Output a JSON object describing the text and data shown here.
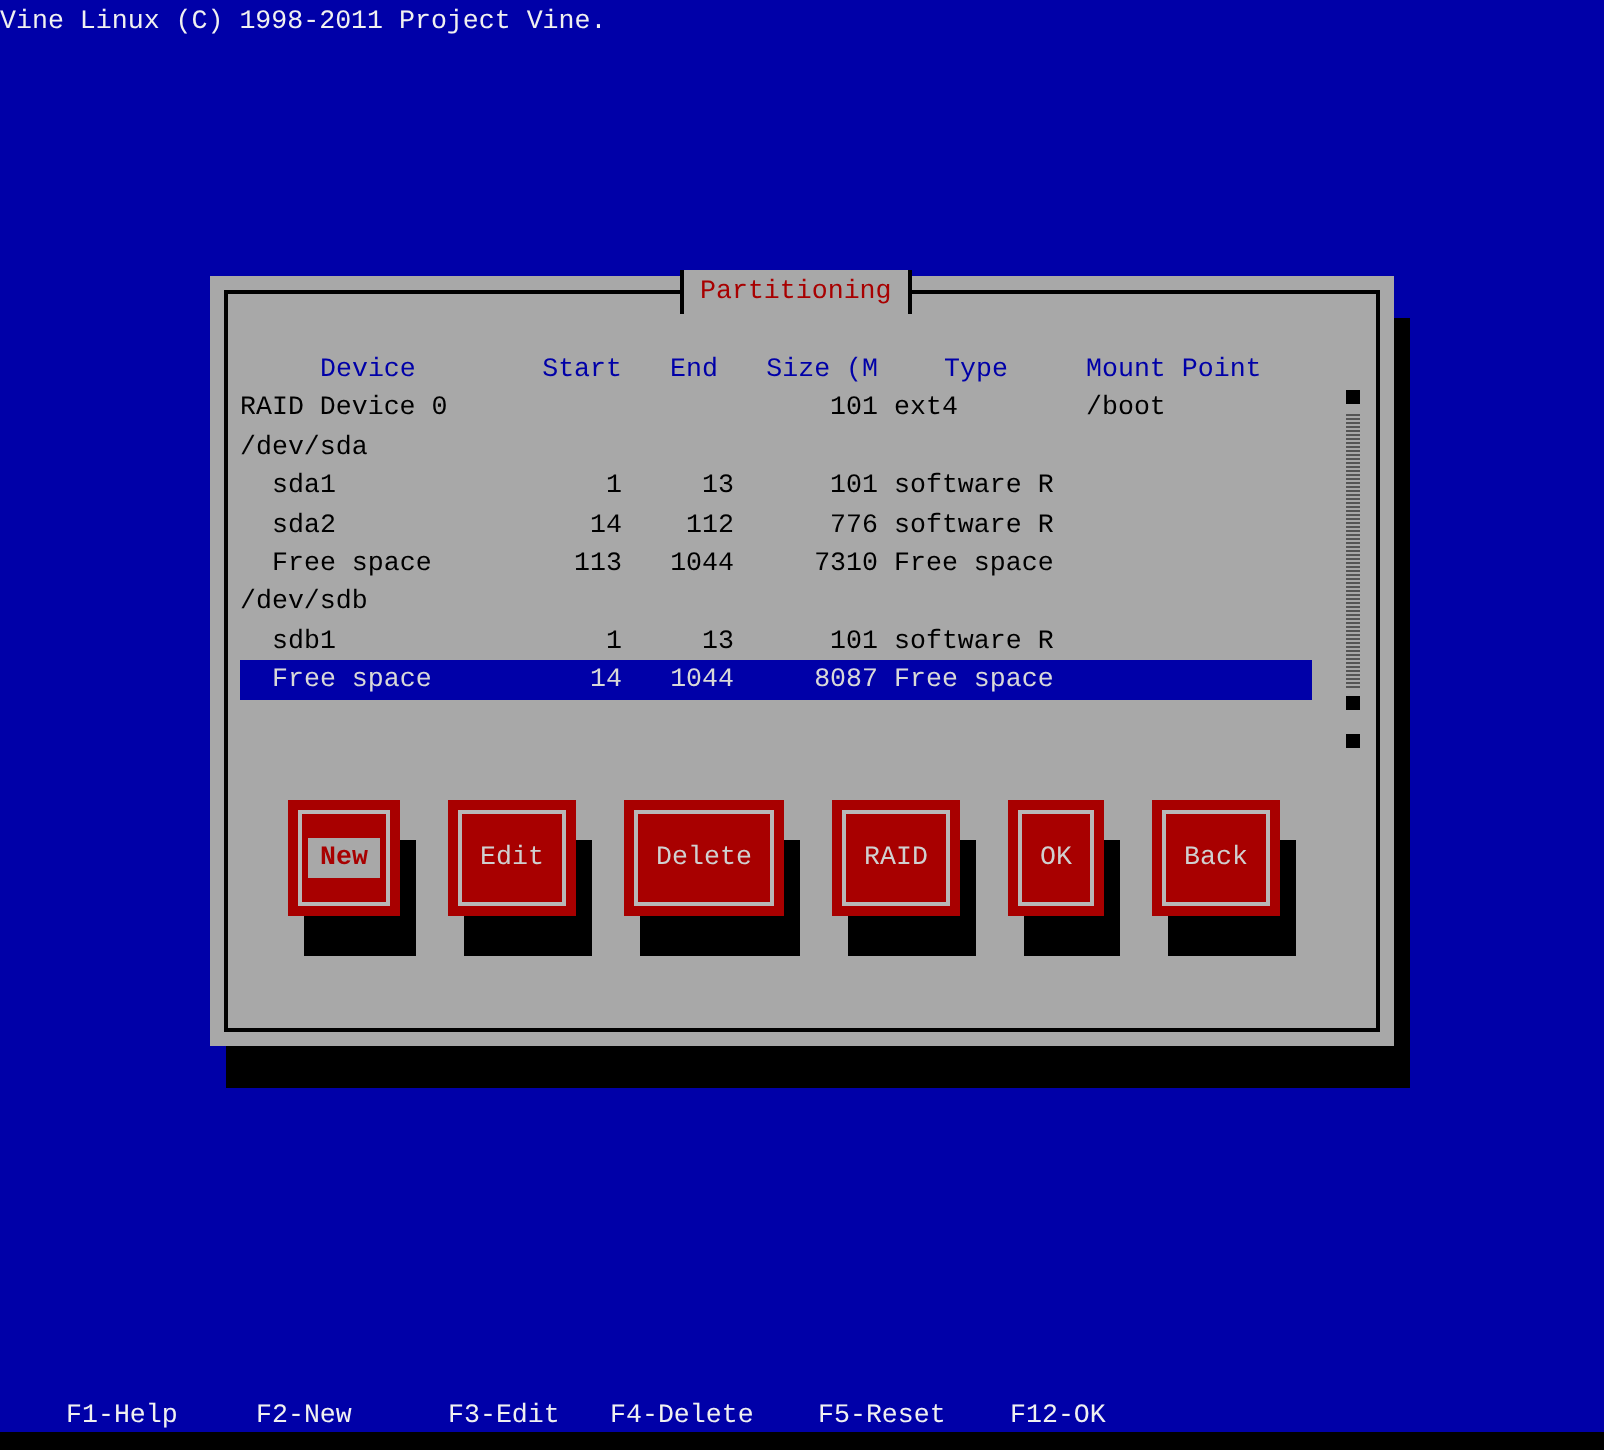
{
  "banner": "Vine Linux (C) 1998-2011 Project Vine.",
  "dialog": {
    "title": "Partitioning",
    "columns": [
      "Device",
      "Start",
      "End",
      "Size (M",
      "Type",
      "Mount Point"
    ],
    "rows": [
      {
        "device": "RAID Device 0",
        "size": "101",
        "type": "ext4",
        "mount_point": "/boot",
        "selected": false
      },
      {
        "device": "/dev/sda",
        "selected": false,
        "children": [
          {
            "device": "sda1",
            "start": "1",
            "end": "13",
            "size": "101",
            "type": "software R",
            "selected": false
          },
          {
            "device": "sda2",
            "start": "14",
            "end": "112",
            "size": "776",
            "type": "software R",
            "selected": false
          },
          {
            "device": "Free space",
            "start": "113",
            "end": "1044",
            "size": "7310",
            "type": "Free space",
            "selected": false
          }
        ]
      },
      {
        "device": "/dev/sdb",
        "selected": false,
        "children": [
          {
            "device": "sdb1",
            "start": "1",
            "end": "13",
            "size": "101",
            "type": "software R",
            "selected": false
          },
          {
            "device": "Free space",
            "start": "14",
            "end": "1044",
            "size": "8087",
            "type": "Free space",
            "selected": true
          }
        ]
      }
    ],
    "buttons": [
      {
        "label": "New",
        "focused": true
      },
      {
        "label": "Edit",
        "focused": false
      },
      {
        "label": "Delete",
        "focused": false
      },
      {
        "label": "RAID",
        "focused": false
      },
      {
        "label": "OK",
        "focused": false
      },
      {
        "label": "Back",
        "focused": false
      }
    ]
  },
  "hints": [
    "F1-Help",
    "F2-New",
    "F3-Edit",
    "F4-Delete",
    "F5-Reset",
    "F12-OK"
  ]
}
